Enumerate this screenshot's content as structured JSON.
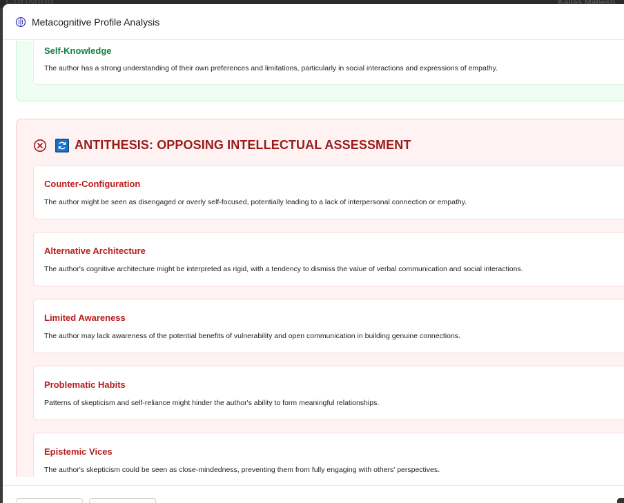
{
  "background": {
    "brand": "CortMind",
    "user": "Kailas Mahesh"
  },
  "modal": {
    "title": "Metacognitive Profile Analysis",
    "icon": "brain-icon"
  },
  "thesis": {
    "card": {
      "title": "Self-Knowledge",
      "text": "The author has a strong understanding of their own preferences and limitations, particularly in social interactions and expressions of empathy."
    }
  },
  "antithesis": {
    "title": "ANTITHESIS: OPPOSING INTELLECTUAL ASSESSMENT",
    "icons": [
      "x-circle-icon",
      "cycle-icon"
    ],
    "cards": [
      {
        "title": "Counter-Configuration",
        "text": "The author might be seen as disengaged or overly self-focused, potentially leading to a lack of interpersonal connection or empathy."
      },
      {
        "title": "Alternative Architecture",
        "text": "The author's cognitive architecture might be interpreted as rigid, with a tendency to dismiss the value of verbal communication and social interactions."
      },
      {
        "title": "Limited Awareness",
        "text": "The author may lack awareness of the potential benefits of vulnerability and open communication in building genuine connections."
      },
      {
        "title": "Problematic Habits",
        "text": "Patterns of skepticism and self-reliance might hinder the author's ability to form meaningful relationships."
      },
      {
        "title": "Epistemic Vices",
        "text": "The author's skepticism could be seen as close-mindedness, preventing them from fully engaging with others' perspectives."
      }
    ]
  },
  "colors": {
    "thesis_accent": "#15803d",
    "antithesis_accent": "#991b1b",
    "antithesis_card_title": "#b91c1c",
    "antithesis_bg": "#fef2f2",
    "thesis_bg": "#f0fdf4",
    "cycle_icon_bg": "#1a73c8"
  }
}
